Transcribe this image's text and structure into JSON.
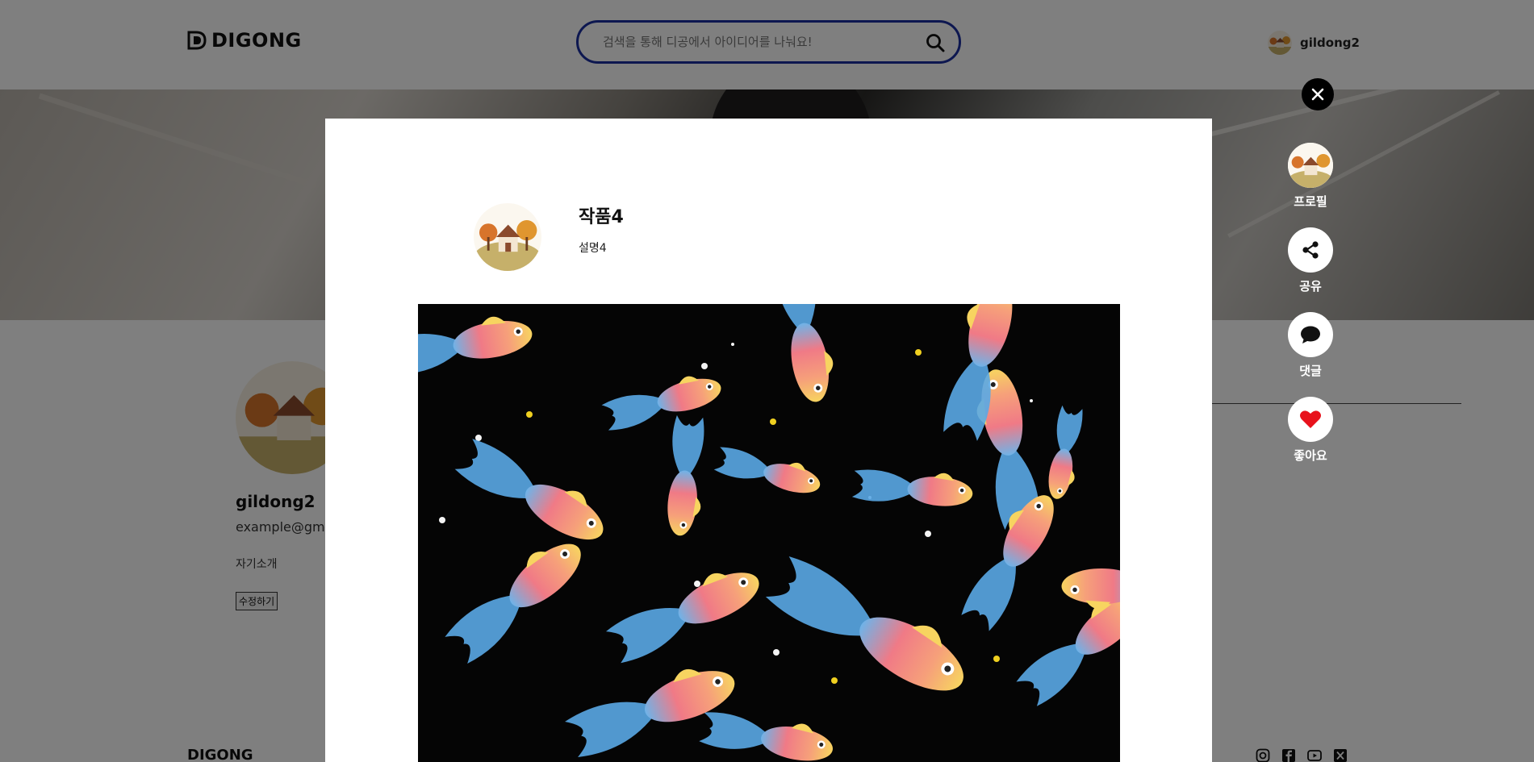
{
  "header": {
    "logo_text": "DIGONG",
    "search_placeholder": "검색을 통해 디공에서 아이디어를 나눠요!",
    "username": "gildong2"
  },
  "profile": {
    "name": "gildong2",
    "email": "example@gma",
    "intro": "자기소개",
    "edit_label": "수정하기"
  },
  "footer": {
    "logo_text": "DIGONG",
    "social_icons": [
      "instagram-icon",
      "facebook-icon",
      "youtube-icon",
      "x-icon"
    ]
  },
  "modal": {
    "title": "작품4",
    "description": "설명4",
    "close_symbol": "✕"
  },
  "side_actions": [
    {
      "label": "프로필",
      "icon": "profile-avatar"
    },
    {
      "label": "공유",
      "icon": "share-icon"
    },
    {
      "label": "댓글",
      "icon": "comment-icon"
    },
    {
      "label": "좋아요",
      "icon": "heart-icon"
    }
  ],
  "colors": {
    "accent": "#1a2fa0",
    "heart": "#e8121c",
    "overlay": "rgba(0,0,0,0.5)"
  }
}
